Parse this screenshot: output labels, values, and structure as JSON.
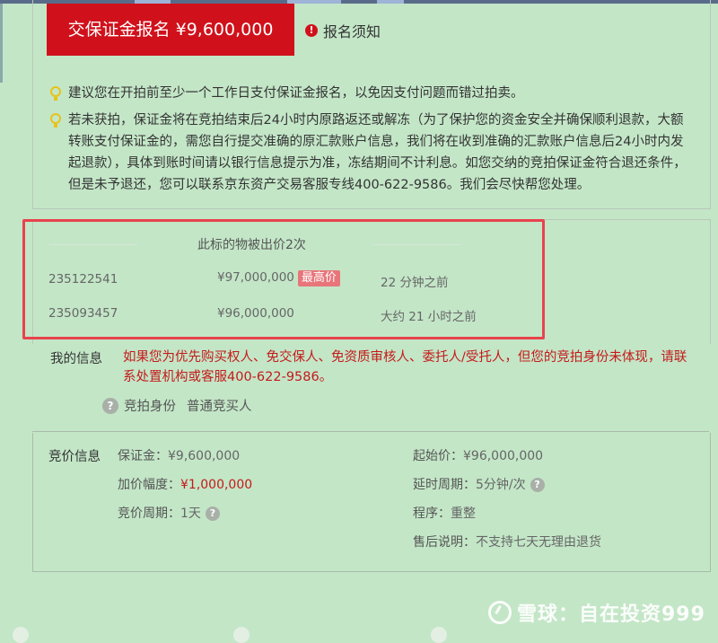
{
  "deposit_button": {
    "label": "交保证金报名 ¥9,600,000"
  },
  "notice_link": {
    "label": "报名须知"
  },
  "tips": [
    "建议您在开拍前至少一个工作日支付保证金报名，以免因支付问题而错过拍卖。",
    "若未获拍，保证金将在竞拍结束后24小时内原路返还或解冻（为了保护您的资金安全并确保顺利退款，大额转账支付保证金的，需您自行提交准确的原汇款账户信息，我们将在收到准确的汇款账户信息后24小时内发起退款），具体到账时间请以银行信息提示为准，冻结期间不计利息。如您交纳的竞拍保证金符合退还条件，但是未予退还，您可以联系京东资产交易客服专线400-622-9586。我们会尽快帮您处理。"
  ],
  "bids": {
    "title": "此标的物被出价2次",
    "rows": [
      {
        "bidder": "235122541",
        "price": "¥97,000,000",
        "badge": "最高价",
        "time": "22 分钟之前"
      },
      {
        "bidder": "235093457",
        "price": "¥96,000,000",
        "badge": "",
        "time": "大约 21 小时之前"
      }
    ]
  },
  "my_info": {
    "label": "我的信息",
    "warning": "如果您为优先购买权人、免交保人、免资质审核人、委托人/受托人，但您的竞拍身份未体现，请联系处置机构或客服400-622-9586。",
    "identity_label": "竞拍身份",
    "identity_value": "普通竞买人"
  },
  "terms": {
    "label": "竞价信息",
    "deposit_label": "保证金：",
    "deposit_value": "¥9,600,000",
    "increment_label": "加价幅度：",
    "increment_value": "¥1,000,000",
    "cycle_label": "竞价周期：",
    "cycle_value": "1天",
    "start_label": "起始价：",
    "start_value": "¥96,000,000",
    "extend_label": "延时周期：",
    "extend_value": "5分钟/次",
    "procedure_label": "程序：",
    "procedure_value": "重整",
    "aftersale_label": "售后说明：",
    "aftersale_value": "不支持七天无理由退货"
  },
  "watermark": {
    "text": "雪球：自在投资999"
  },
  "colors": {
    "accent": "#d0111b",
    "background": "#c3e6c7",
    "highlight": "#e8434d",
    "warning_text": "#c41a1a"
  }
}
